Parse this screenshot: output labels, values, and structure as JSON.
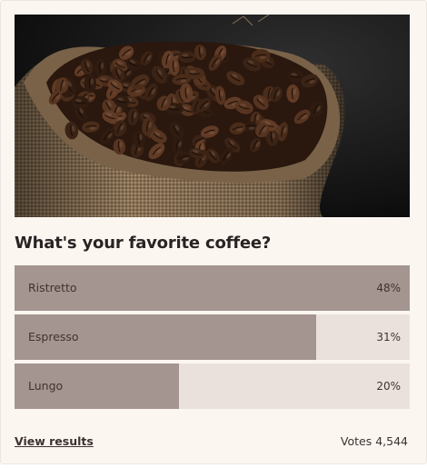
{
  "poll": {
    "image_alt": "Burlap sack filled with roasted coffee beans",
    "question": "What's your favorite coffee?",
    "options": [
      {
        "label": "Ristretto",
        "percent_text": "48%",
        "fill": 1.0
      },
      {
        "label": "Espresso",
        "percent_text": "31%",
        "fill": 0.764
      },
      {
        "label": "Lungo",
        "percent_text": "20%",
        "fill": 0.416
      }
    ],
    "view_results_label": "View results",
    "votes_text": "Votes 4,544"
  },
  "colors": {
    "card_background": "#fcf6f1",
    "bar_fill": "#a59591",
    "bar_track": "#ebe1dc",
    "text": "#2a2323"
  }
}
